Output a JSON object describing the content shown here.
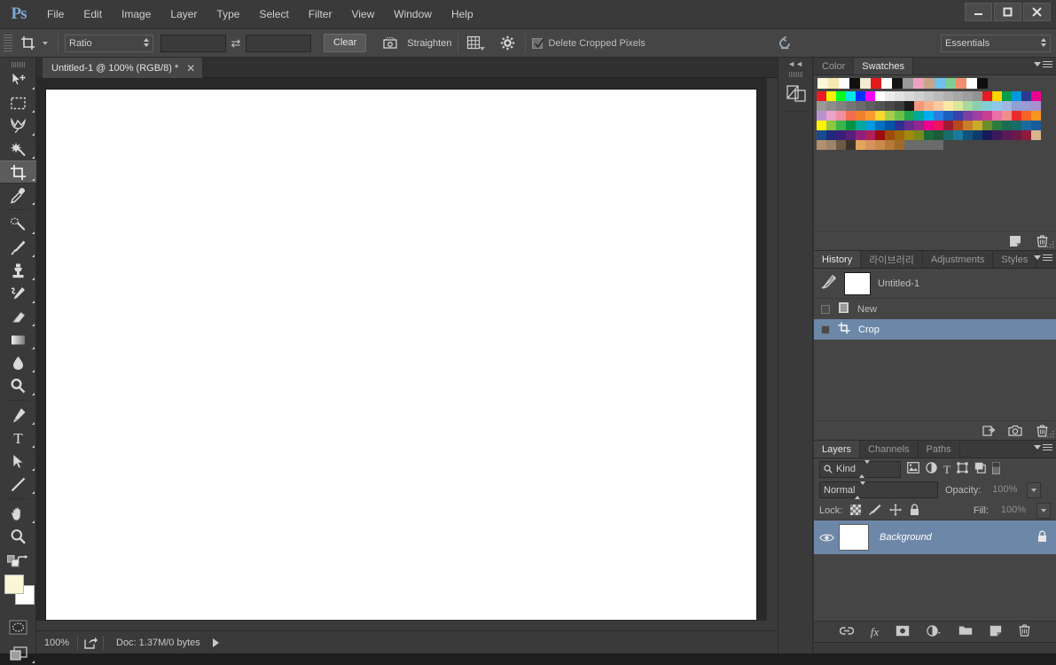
{
  "app": {
    "logo": "Ps",
    "menus": [
      "File",
      "Edit",
      "Image",
      "Layer",
      "Type",
      "Select",
      "Filter",
      "View",
      "Window",
      "Help"
    ],
    "window_controls": [
      {
        "name": "minimize-button",
        "glyph": "—"
      },
      {
        "name": "maximize-button",
        "glyph": "❐"
      },
      {
        "name": "close-button",
        "glyph": "✕"
      }
    ]
  },
  "options_bar": {
    "tool_icon": "crop-tool-icon",
    "ratio_select": "Ratio",
    "width_field": "",
    "width_placeholder": "",
    "height_field": "",
    "height_placeholder": "",
    "swap_label": "⇄",
    "clear_button": "Clear",
    "straighten_label": "Straighten",
    "overlay_icon": "grid-overlay-icon",
    "settings_icon": "gear-icon",
    "delete_cropped_label": "Delete Cropped Pixels",
    "delete_cropped_checked": true,
    "reset_icon": "reset-icon",
    "workspace_select": "Essentials"
  },
  "toolbar": {
    "tools": [
      {
        "name": "move-tool",
        "label": "Move Tool",
        "active": false,
        "has_flyout": true
      },
      {
        "name": "marquee-tool",
        "label": "Rectangular Marquee Tool",
        "active": false,
        "has_flyout": true
      },
      {
        "name": "lasso-tool",
        "label": "Lasso Tool",
        "active": false,
        "has_flyout": true
      },
      {
        "name": "magic-wand-tool",
        "label": "Quick Selection Tool",
        "active": false,
        "has_flyout": true
      },
      {
        "name": "crop-tool",
        "label": "Crop Tool",
        "active": true,
        "has_flyout": true
      },
      {
        "name": "eyedropper-tool",
        "label": "Eyedropper Tool",
        "active": false,
        "has_flyout": true
      },
      {
        "name": "healing-brush-tool",
        "label": "Spot Healing Brush Tool",
        "active": false,
        "has_flyout": true
      },
      {
        "name": "brush-tool",
        "label": "Brush Tool",
        "active": false,
        "has_flyout": true
      },
      {
        "name": "clone-stamp-tool",
        "label": "Clone Stamp Tool",
        "active": false,
        "has_flyout": true
      },
      {
        "name": "history-brush-tool",
        "label": "History Brush Tool",
        "active": false,
        "has_flyout": true
      },
      {
        "name": "eraser-tool",
        "label": "Eraser Tool",
        "active": false,
        "has_flyout": true
      },
      {
        "name": "gradient-tool",
        "label": "Gradient Tool",
        "active": false,
        "has_flyout": true
      },
      {
        "name": "blur-tool",
        "label": "Blur Tool",
        "active": false,
        "has_flyout": true
      },
      {
        "name": "dodge-tool",
        "label": "Dodge Tool",
        "active": false,
        "has_flyout": true
      },
      {
        "name": "pen-tool",
        "label": "Pen Tool",
        "active": false,
        "has_flyout": true
      },
      {
        "name": "type-tool",
        "label": "Horizontal Type Tool",
        "active": false,
        "has_flyout": true
      },
      {
        "name": "path-selection-tool",
        "label": "Path Selection Tool",
        "active": false,
        "has_flyout": true
      },
      {
        "name": "line-tool",
        "label": "Line Tool",
        "active": false,
        "has_flyout": true
      },
      {
        "name": "hand-tool",
        "label": "Hand Tool",
        "active": false,
        "has_flyout": true
      },
      {
        "name": "zoom-tool",
        "label": "Zoom Tool",
        "active": false,
        "has_flyout": false
      }
    ],
    "foreground_color": "#fbf7d6",
    "background_color": "#ffffff",
    "quick_mask_label": "Edit in Quick Mask Mode",
    "screen_mode_label": "Change Screen Mode"
  },
  "document": {
    "tab_title": "Untitled-1 @ 100% (RGB/8) *",
    "close_glyph": "✕"
  },
  "status_bar": {
    "zoom": "100%",
    "share_icon": "share-icon",
    "doc_info": "Doc: 1.37M/0 bytes"
  },
  "dock_strip": {
    "collapse_glyph": "◄◄",
    "icon": "snapshot-panel-icon"
  },
  "swatches_panel": {
    "tabs": [
      {
        "label": "Color",
        "active": false
      },
      {
        "label": "Swatches",
        "active": true
      }
    ],
    "recent": [
      "#fbf7dc",
      "#f5e8b0",
      "#fdfdfd",
      "#111111",
      "#f2ecd2",
      "#e01b1b",
      "#ffffff",
      "#141414",
      "#9a9a9a",
      "#efa0bd",
      "#c9a48a",
      "#6fc0ea",
      "#7fce90",
      "#f08f70",
      "#ffffff",
      "#0f0f0f"
    ],
    "grid": [
      "#ed1c24",
      "#fff200",
      "#00ff21",
      "#00e5e5",
      "#0033ff",
      "#ff00ff",
      "#ffffff",
      "#ececec",
      "#e2e2e2",
      "#d8d8d8",
      "#cfcfcf",
      "#c5c5c5",
      "#bbbbbb",
      "#b1b1b1",
      "#a7a7a7",
      "#9d9d9d",
      "#939393",
      "#e31b23",
      "#ffd400",
      "#009e49",
      "#0099dd",
      "#2b3990",
      "#ec008c",
      "#999999",
      "#8d8d8d",
      "#828282",
      "#767676",
      "#6b6b6b",
      "#5f5f5f",
      "#545454",
      "#484848",
      "#3d3d3d",
      "#1a1a1a",
      "#f4977c",
      "#f6b18a",
      "#f9cba0",
      "#fbe9a8",
      "#d9e89a",
      "#a8d9a0",
      "#8ccfb0",
      "#7fcfd6",
      "#8dc8ea",
      "#9fb8e2",
      "#8f9fd4",
      "#9a9ad4",
      "#a98fd0",
      "#bb92d0",
      "#e8a3c8",
      "#ef8fa0",
      "#f26d50",
      "#f08030",
      "#f59a2e",
      "#fbd731",
      "#a5cf4a",
      "#6cc04a",
      "#22a651",
      "#00a99d",
      "#00aeef",
      "#2a7de1",
      "#1b5fbf",
      "#3b3fa8",
      "#7b3fa0",
      "#a03fa0",
      "#c83f8f",
      "#e86fa8",
      "#ef8d8d",
      "#e82c2c",
      "#f26522",
      "#f7941e",
      "#fff200",
      "#8dc63f",
      "#39b54a",
      "#009245",
      "#00a99d",
      "#0099dd",
      "#0071bc",
      "#0054a6",
      "#2e3192",
      "#662d91",
      "#92278f",
      "#ec008c",
      "#ed145b",
      "#9e1b32",
      "#b5481b",
      "#c87f2a",
      "#c9aa2a",
      "#6a8f2a",
      "#2d7a3e",
      "#1a6b52",
      "#1a6b6b",
      "#1a6ba0",
      "#1a5ba0",
      "#1a4b8f",
      "#1f2a7a",
      "#3a1f7a",
      "#5a1f7a",
      "#8f1f7a",
      "#b01f5a",
      "#9e0b0b",
      "#9e4b0b",
      "#a06a0b",
      "#a08a0b",
      "#7a8a1a",
      "#1a6b3a",
      "#1a5b3a",
      "#1a6b6b",
      "#1a7a9e",
      "#12527a",
      "#0d3c6b",
      "#1a1a5a",
      "#3a1a5a",
      "#5a1a5a",
      "#6b1a4a",
      "#8f1a3a",
      "#d8b48c",
      "#b09070",
      "#9e8468",
      "#6b5a45",
      "#3a3228",
      "#e2a45c",
      "#d8945c",
      "#c98a4a",
      "#b5793a",
      "#a06a2a",
      "#6b6b6b",
      "#6b6b6b",
      "#6b6b6b",
      "#6b6b6b"
    ],
    "footer_icons": [
      {
        "name": "new-swatch-icon"
      },
      {
        "name": "delete-swatch-icon"
      }
    ]
  },
  "history_panel": {
    "tabs": [
      {
        "label": "History",
        "active": true
      },
      {
        "label": "라이브러리",
        "active": false
      },
      {
        "label": "Adjustments",
        "active": false
      },
      {
        "label": "Styles",
        "active": false
      }
    ],
    "snapshot": {
      "name": "Untitled-1",
      "icon": "history-brush-source-icon"
    },
    "states": [
      {
        "label": "New",
        "icon": "new-document-icon",
        "selected": false
      },
      {
        "label": "Crop",
        "icon": "crop-state-icon",
        "selected": true
      }
    ],
    "footer_icons": [
      {
        "name": "new-document-from-state-icon"
      },
      {
        "name": "create-snapshot-icon"
      },
      {
        "name": "delete-state-icon"
      }
    ]
  },
  "layers_panel": {
    "tabs": [
      {
        "label": "Layers",
        "active": true
      },
      {
        "label": "Channels",
        "active": false
      },
      {
        "label": "Paths",
        "active": false
      }
    ],
    "filter_kind": "Kind",
    "filter_icons": [
      {
        "name": "filter-pixel-icon"
      },
      {
        "name": "filter-adjustment-icon"
      },
      {
        "name": "filter-type-icon"
      },
      {
        "name": "filter-shape-icon"
      },
      {
        "name": "filter-smart-object-icon"
      },
      {
        "name": "filter-toggle-icon"
      }
    ],
    "blend_mode": "Normal",
    "opacity_label": "Opacity:",
    "opacity_value": "100%",
    "lock_label": "Lock:",
    "lock_icons": [
      {
        "name": "lock-transparency-icon"
      },
      {
        "name": "lock-image-icon"
      },
      {
        "name": "lock-position-icon"
      },
      {
        "name": "lock-all-icon"
      }
    ],
    "fill_label": "Fill:",
    "fill_value": "100%",
    "layers": [
      {
        "name": "Background",
        "visible": true,
        "locked": true,
        "selected": true
      }
    ],
    "footer_icons": [
      {
        "name": "link-layers-icon"
      },
      {
        "name": "layer-style-fx-icon",
        "label": "fx"
      },
      {
        "name": "add-layer-mask-icon"
      },
      {
        "name": "new-adjustment-layer-icon"
      },
      {
        "name": "new-group-icon"
      },
      {
        "name": "new-layer-icon"
      },
      {
        "name": "delete-layer-icon"
      }
    ]
  }
}
